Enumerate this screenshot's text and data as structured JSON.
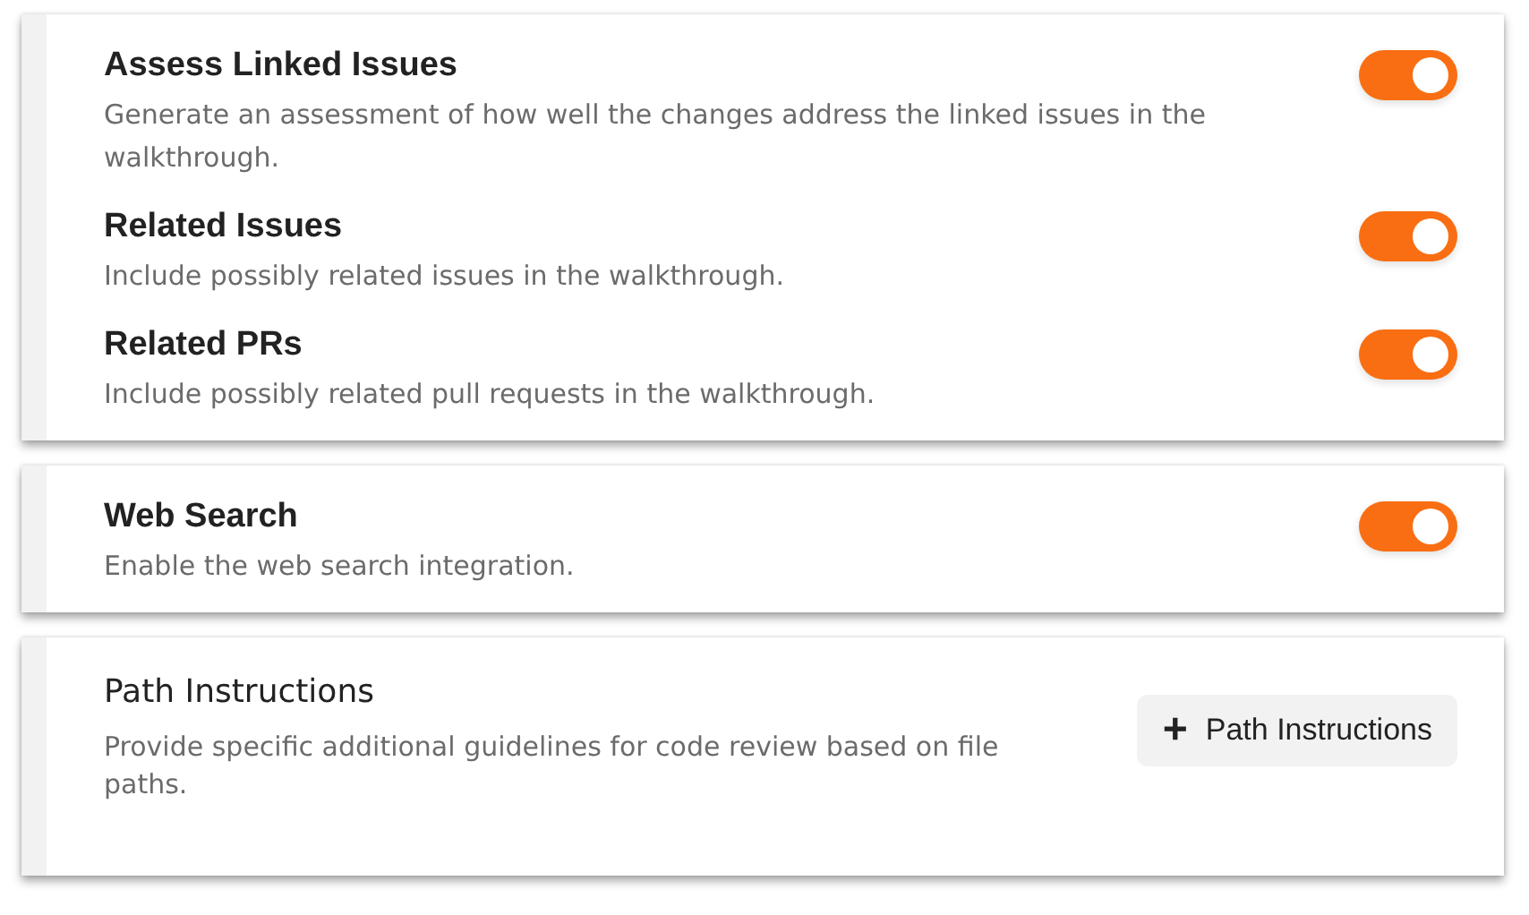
{
  "cards": [
    {
      "kind": "toggles",
      "settings": [
        {
          "title": "Assess Linked Issues",
          "description": "Generate an assessment of how well the changes address the linked issues in the walkthrough.",
          "on": true
        },
        {
          "title": "Related Issues",
          "description": "Include possibly related issues in the walkthrough.",
          "on": true
        },
        {
          "title": "Related PRs",
          "description": "Include possibly related pull requests in the walkthrough.",
          "on": true
        }
      ]
    },
    {
      "kind": "toggles",
      "settings": [
        {
          "title": "Web Search",
          "description": "Enable the web search integration.",
          "on": true
        }
      ]
    },
    {
      "kind": "action",
      "title": "Path Instructions",
      "description": "Provide specific additional guidelines for code review based on file paths.",
      "button": {
        "icon": "+",
        "label": "Path Instructions"
      }
    }
  ]
}
